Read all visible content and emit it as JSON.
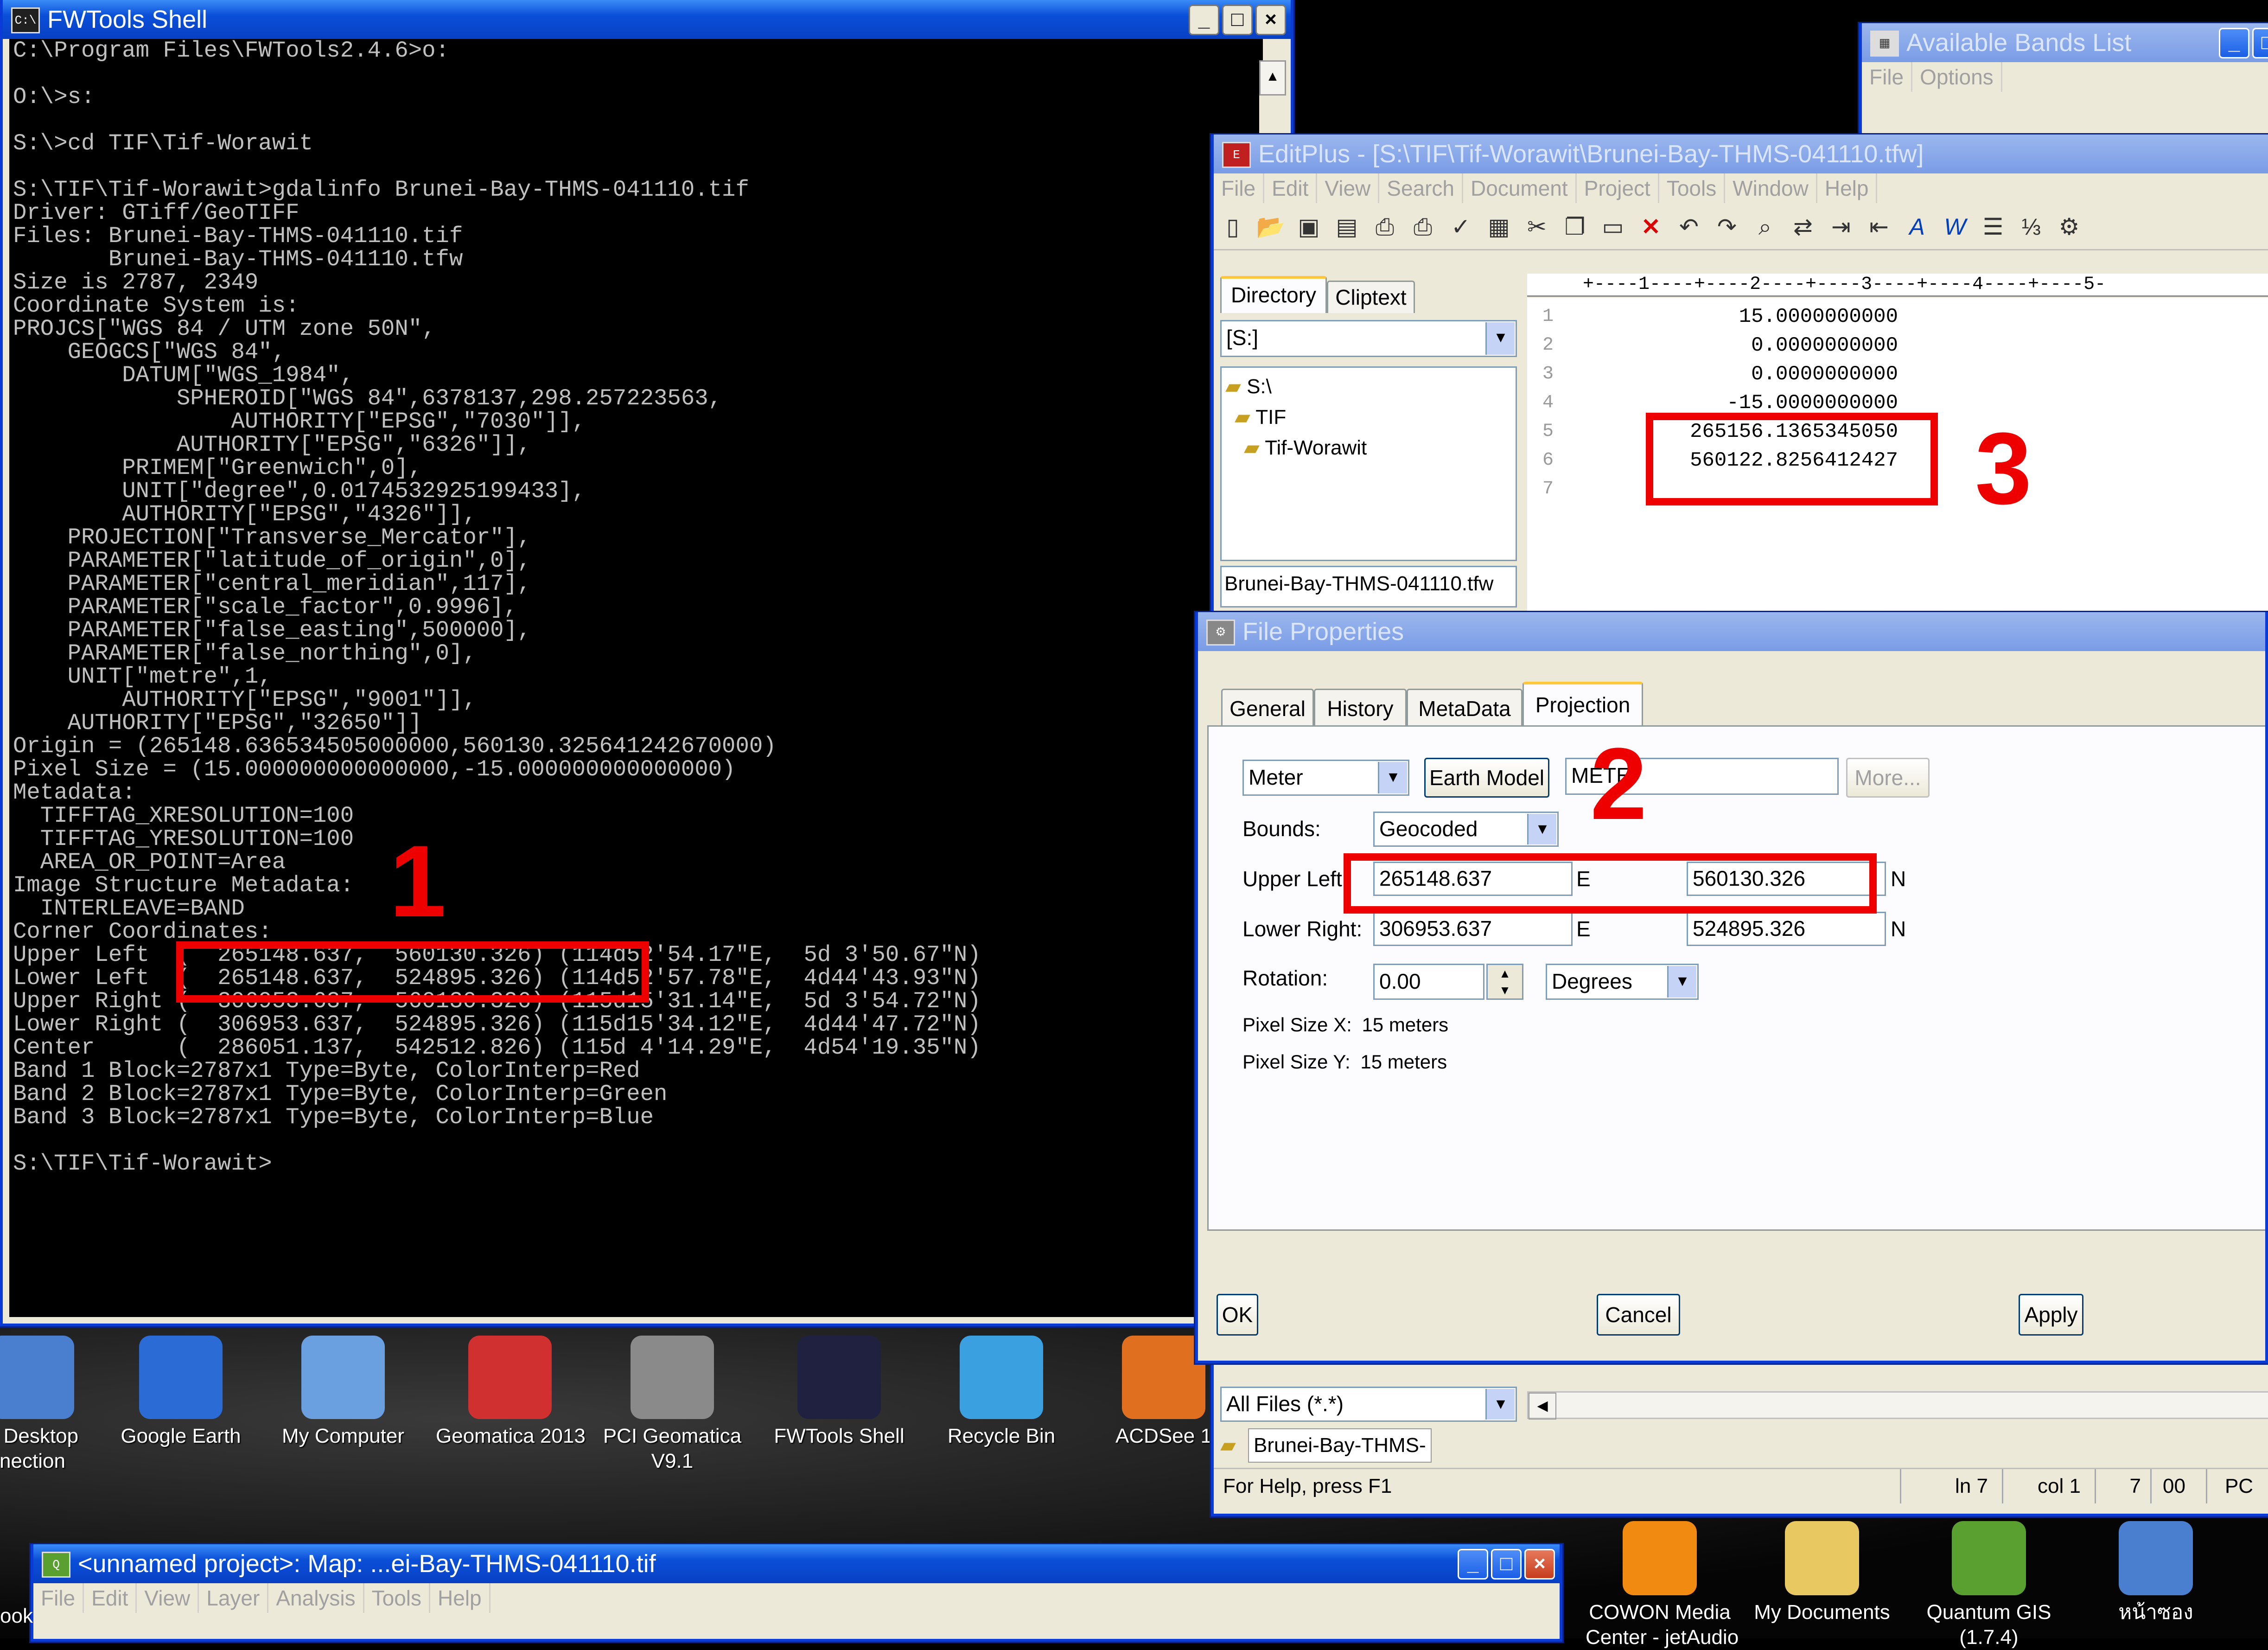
{
  "fwtools": {
    "title": "FWTools Shell",
    "icon": "C:\\",
    "lines": [
      "C:\\Program Files\\FWTools2.4.6>o:",
      "",
      "O:\\>s:",
      "",
      "S:\\>cd TIF\\Tif-Worawit",
      "",
      "S:\\TIF\\Tif-Worawit>gdalinfo Brunei-Bay-THMS-041110.tif",
      "Driver: GTiff/GeoTIFF",
      "Files: Brunei-Bay-THMS-041110.tif",
      "       Brunei-Bay-THMS-041110.tfw",
      "Size is 2787, 2349",
      "Coordinate System is:",
      "PROJCS[\"WGS 84 / UTM zone 50N\",",
      "    GEOGCS[\"WGS 84\",",
      "        DATUM[\"WGS_1984\",",
      "            SPHEROID[\"WGS 84\",6378137,298.257223563,",
      "                AUTHORITY[\"EPSG\",\"7030\"]],",
      "            AUTHORITY[\"EPSG\",\"6326\"]],",
      "        PRIMEM[\"Greenwich\",0],",
      "        UNIT[\"degree\",0.0174532925199433],",
      "        AUTHORITY[\"EPSG\",\"4326\"]],",
      "    PROJECTION[\"Transverse_Mercator\"],",
      "    PARAMETER[\"latitude_of_origin\",0],",
      "    PARAMETER[\"central_meridian\",117],",
      "    PARAMETER[\"scale_factor\",0.9996],",
      "    PARAMETER[\"false_easting\",500000],",
      "    PARAMETER[\"false_northing\",0],",
      "    UNIT[\"metre\",1,",
      "        AUTHORITY[\"EPSG\",\"9001\"]],",
      "    AUTHORITY[\"EPSG\",\"32650\"]]",
      "Origin = (265148.636534505000000,560130.325641242670000)",
      "Pixel Size = (15.000000000000000,-15.000000000000000)",
      "Metadata:",
      "  TIFFTAG_XRESOLUTION=100",
      "  TIFFTAG_YRESOLUTION=100",
      "  AREA_OR_POINT=Area",
      "Image Structure Metadata:",
      "  INTERLEAVE=BAND",
      "Corner Coordinates:",
      "Upper Left  (  265148.637,  560130.326) (114d52'54.17\"E,  5d 3'50.67\"N)",
      "Lower Left  (  265148.637,  524895.326) (114d52'57.78\"E,  4d44'43.93\"N)",
      "Upper Right (  306953.637,  560130.326) (115d15'31.14\"E,  5d 3'54.72\"N)",
      "Lower Right (  306953.637,  524895.326) (115d15'34.12\"E,  4d44'47.72\"N)",
      "Center      (  286051.137,  542512.826) (115d 4'14.29\"E,  4d54'19.35\"N)",
      "Band 1 Block=2787x1 Type=Byte, ColorInterp=Red",
      "Band 2 Block=2787x1 Type=Byte, ColorInterp=Green",
      "Band 3 Block=2787x1 Type=Byte, ColorInterp=Blue",
      "",
      "S:\\TIF\\Tif-Worawit>"
    ]
  },
  "bands": {
    "title": "Available Bands List",
    "menu": [
      "File",
      "Options"
    ]
  },
  "editplus": {
    "title": "EditPlus - [S:\\TIF\\Tif-Worawit\\Brunei-Bay-THMS-041110.tfw]",
    "menu": [
      "File",
      "Edit",
      "View",
      "Search",
      "Document",
      "Project",
      "Tools",
      "Window",
      "Help"
    ],
    "tabs": [
      "Directory",
      "Cliptext"
    ],
    "drive": "[S:]",
    "tree": [
      "S:\\",
      "TIF",
      "Tif-Worawit"
    ],
    "files": [
      "Brunei-Bay-THMS-041110.tfw"
    ],
    "ruler": "+----1----+----2----+----3----+----4----+----5-",
    "line_numbers": [
      "1",
      "2",
      "3",
      "4",
      "5",
      "6",
      "7"
    ],
    "lines": [
      "15.0000000000",
      "0.0000000000",
      "0.0000000000",
      "-15.0000000000",
      "265156.1365345050",
      "560122.8256412427",
      ""
    ],
    "filter": "All Files (*.*)",
    "open_tab": "Brunei-Bay-THMS-",
    "status": {
      "help": "For Help, press F1",
      "ln": "ln 7",
      "col": "col 1",
      "num": "7",
      "zero": "00",
      "pc": "PC"
    }
  },
  "fileprops": {
    "title": "File Properties",
    "tabs": [
      "General",
      "History",
      "MetaData",
      "Projection"
    ],
    "unit": "Meter",
    "earth_model_btn": "Earth Model",
    "earth_model_val": "METE",
    "more_btn": "More...",
    "bounds_label": "Bounds:",
    "bounds_val": "Geocoded",
    "ul_label": "Upper Left:",
    "ul_e": "265148.637",
    "ul_n": "560130.326",
    "lr_label": "Lower Right:",
    "lr_e": "306953.637",
    "lr_n": "524895.326",
    "e": "E",
    "n": "N",
    "rot_label": "Rotation:",
    "rot_val": "0.00",
    "rot_unit": "Degrees",
    "psx_label": "Pixel Size X:",
    "psx_val": "15 meters",
    "psy_label": "Pixel Size Y:",
    "psy_val": "15 meters",
    "ok": "OK",
    "cancel": "Cancel",
    "apply": "Apply"
  },
  "annotations": [
    "1",
    "2",
    "3"
  ],
  "desktop": {
    "icons": [
      {
        "label": "e Desktop\nnection",
        "color": "#4a7fd0"
      },
      {
        "label": "Google Earth",
        "color": "#2b6bd6"
      },
      {
        "label": "My Computer",
        "color": "#6aa0e0"
      },
      {
        "label": "Geomatica 2013",
        "color": "#d03030"
      },
      {
        "label": "PCI Geomatica\nV9.1",
        "color": "#8a8a8a"
      },
      {
        "label": "FWTools Shell",
        "color": "#202040"
      },
      {
        "label": "Recycle Bin",
        "color": "#3aa0e0"
      },
      {
        "label": "ACDSee 1",
        "color": "#e07020"
      }
    ],
    "icons_bottom": [
      {
        "label": "COWON Media\nCenter - jetAudio",
        "color": "#f08a10"
      },
      {
        "label": "My Documents",
        "color": "#e8c860"
      },
      {
        "label": "Quantum GIS\n(1.7.4)",
        "color": "#5aa030"
      },
      {
        "label": "หน้าซอง",
        "color": "#4a7fd0"
      }
    ]
  },
  "qgis": {
    "title": "<unnamed project>: Map: ...ei-Bay-THMS-041110.tif",
    "menu": [
      "File",
      "Edit",
      "View",
      "Layer",
      "Analysis",
      "Tools",
      "Help"
    ],
    "side_label": "ook"
  }
}
